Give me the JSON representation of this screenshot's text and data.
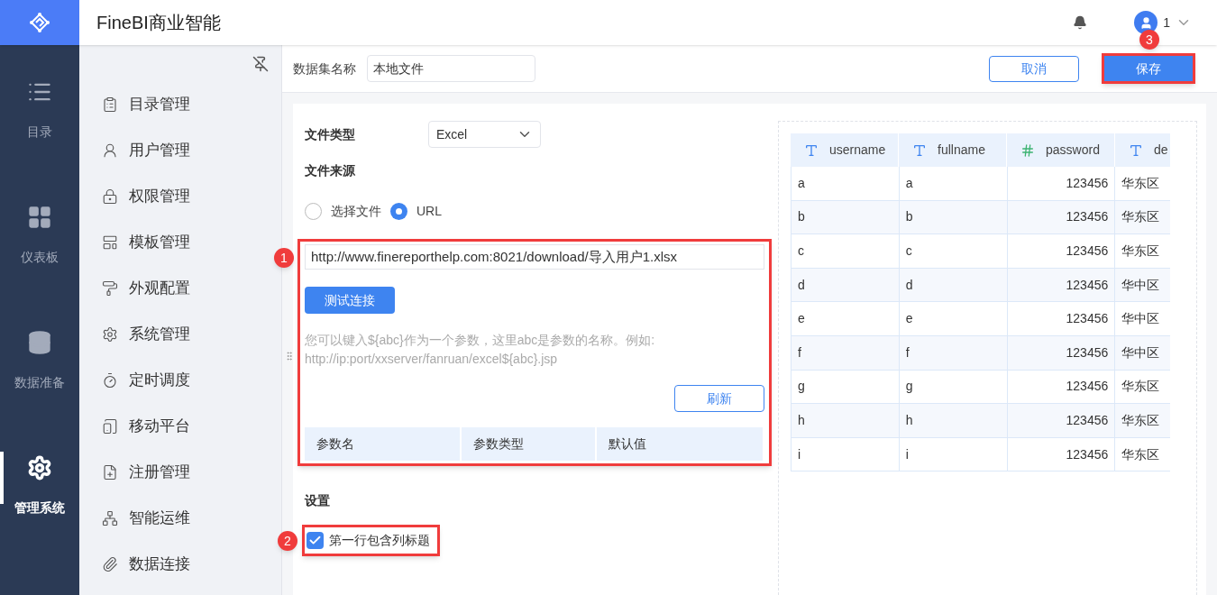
{
  "app": {
    "title": "FineBI商业智能"
  },
  "rail": [
    {
      "label": "目录",
      "selected": false
    },
    {
      "label": "仪表板",
      "selected": false
    },
    {
      "label": "数据准备",
      "selected": false
    },
    {
      "label": "管理系统",
      "selected": true
    }
  ],
  "menu": [
    "目录管理",
    "用户管理",
    "权限管理",
    "模板管理",
    "外观配置",
    "系统管理",
    "定时调度",
    "移动平台",
    "注册管理",
    "智能运维",
    "数据连接"
  ],
  "user": {
    "name": "1"
  },
  "toolbar": {
    "name_label": "数据集名称",
    "name_value": "本地文件",
    "buttons": [
      {
        "label": "取消",
        "kind": "secondary"
      },
      {
        "label": "保存",
        "kind": "primary"
      }
    ]
  },
  "form": {
    "file_type_label": "文件类型",
    "file_type_value": "Excel",
    "source_label": "文件来源",
    "source_options": [
      {
        "label": "选择文件",
        "selected": false
      },
      {
        "label": "URL",
        "selected": true
      }
    ],
    "url_value": "http://www.finereporthelp.com:8021/download/导入用户1.xlsx",
    "test_button": "测试连接",
    "hint_lines": [
      "您可以键入${abc}作为一个参数，这里abc是参数的名称。例如:",
      "http://ip:port/xxserver/fanruan/excel${abc}.jsp"
    ],
    "refresh_button": "刷新",
    "param_columns": [
      "参数名",
      "参数类型",
      "默认值"
    ],
    "settings_label": "设置",
    "header_checkbox": {
      "label": "第一行包含列标题",
      "checked": true
    }
  },
  "preview": {
    "columns": [
      {
        "name": "username",
        "kind": "text"
      },
      {
        "name": "fullname",
        "kind": "text"
      },
      {
        "name": "password",
        "kind": "number"
      },
      {
        "name": "de",
        "kind": "text"
      }
    ],
    "rows": [
      [
        "a",
        "a",
        "123456",
        "华东区"
      ],
      [
        "b",
        "b",
        "123456",
        "华东区"
      ],
      [
        "c",
        "c",
        "123456",
        "华东区"
      ],
      [
        "d",
        "d",
        "123456",
        "华中区"
      ],
      [
        "e",
        "e",
        "123456",
        "华中区"
      ],
      [
        "f",
        "f",
        "123456",
        "华中区"
      ],
      [
        "g",
        "g",
        "123456",
        "华东区"
      ],
      [
        "h",
        "h",
        "123456",
        "华东区"
      ],
      [
        "i",
        "i",
        "123456",
        "华东区"
      ]
    ]
  },
  "annotations": [
    {
      "number": "1"
    },
    {
      "number": "2"
    },
    {
      "number": "3"
    }
  ]
}
